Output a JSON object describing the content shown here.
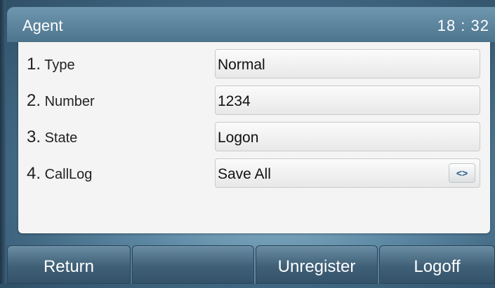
{
  "header": {
    "title": "Agent",
    "clock": "18 : 32"
  },
  "rows": [
    {
      "number": "1.",
      "label": "Type",
      "value": "Normal"
    },
    {
      "number": "2.",
      "label": "Number",
      "value": "1234"
    },
    {
      "number": "3.",
      "label": "State",
      "value": "Logon"
    },
    {
      "number": "4.",
      "label": "CallLog",
      "value": "Save All"
    }
  ],
  "switch_glyph": "<>",
  "softkeys": [
    "Return",
    "",
    "Unregister",
    "Logoff"
  ],
  "colors": {
    "accent": "#2b5e8e",
    "header": "#5a829b",
    "softkey": "#3f6077"
  }
}
